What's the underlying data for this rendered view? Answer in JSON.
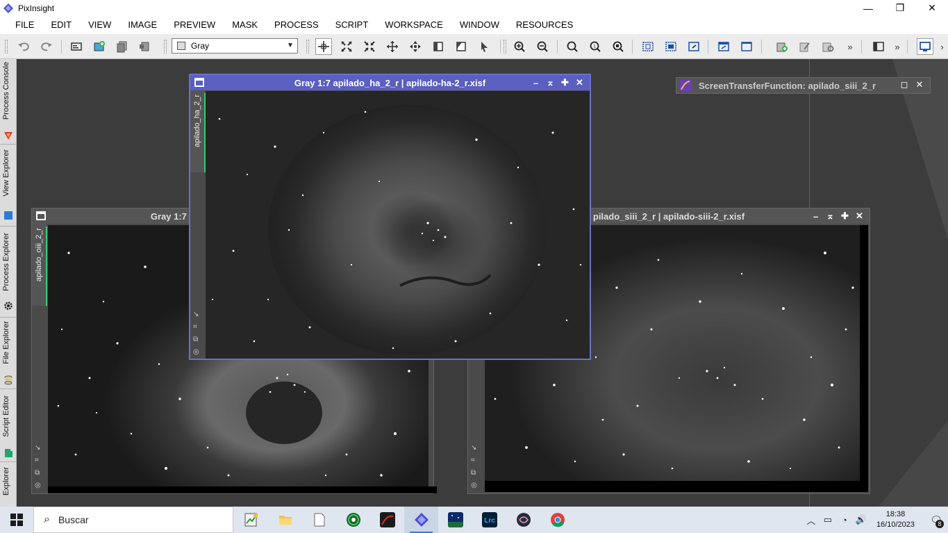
{
  "app": {
    "title": "PixInsight"
  },
  "window_controls": {
    "minimize": "—",
    "restore": "❐",
    "close": "✕"
  },
  "menu": [
    "FILE",
    "EDIT",
    "VIEW",
    "IMAGE",
    "PREVIEW",
    "MASK",
    "PROCESS",
    "SCRIPT",
    "WORKSPACE",
    "WINDOW",
    "RESOURCES"
  ],
  "toolbar": {
    "mode_select": "Gray",
    "mode_arrow": "▼",
    "overflow_1": "»",
    "overflow_2": "»",
    "overflow_3": "›"
  },
  "sidebar": {
    "tabs": [
      "Process Console",
      "View Explorer",
      "Process Explorer",
      "File Explorer",
      "Script Editor",
      "Explorer"
    ]
  },
  "windows": {
    "ha": {
      "title": "Gray 1:7 apilado_ha_2_r | apilado-ha-2_r.xisf",
      "tab": "apilado_ha_2_r"
    },
    "oiii": {
      "title": "Gray 1:7 apilado_o",
      "tab": "apilado_oiii_2_r"
    },
    "siii": {
      "title": "pilado_siii_2_r | apilado-siii-2_r.xisf"
    },
    "buttons": {
      "min": "–",
      "shade": "⌅",
      "max": "✚",
      "close": "✕"
    },
    "vicons": [
      "↘",
      "⌗",
      "⧉",
      "◎"
    ]
  },
  "stf": {
    "title": "ScreenTransferFunction: apilado_siii_2_r",
    "float": "◻",
    "close": "✕"
  },
  "taskbar": {
    "search_placeholder": "Buscar",
    "search_icon": "⌕",
    "time": "18:38",
    "date": "16/10/2023",
    "notifications": "8",
    "tray": {
      "chevron": "︿",
      "battery": "▭",
      "wifi": "◔",
      "volume": "🔊",
      "notification": "🗨"
    }
  },
  "colors": {
    "active_window": "#5a5fc0",
    "tab_accent": "#2ecc71",
    "taskbar": "#dfe6ef"
  }
}
